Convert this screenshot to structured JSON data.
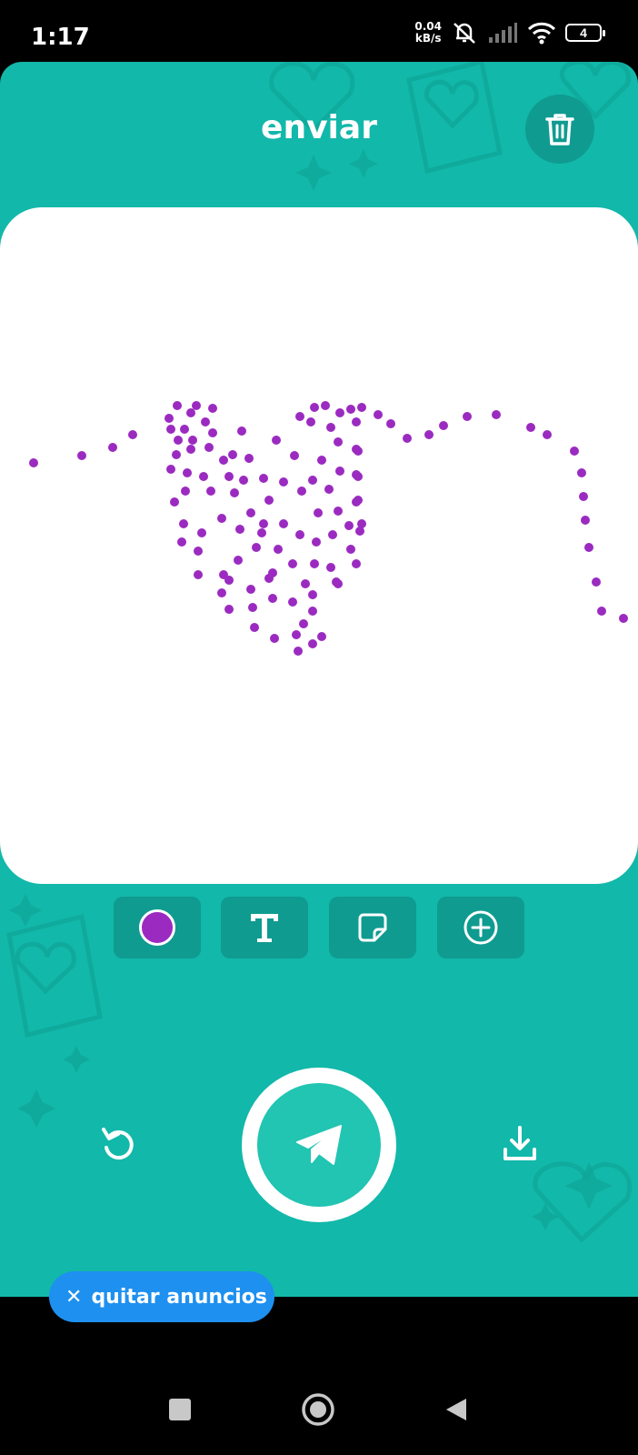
{
  "status_bar": {
    "time": "1:17",
    "net_speed_value": "0.04",
    "net_speed_unit": "kB/s",
    "battery_level": "4"
  },
  "header": {
    "title": "enviar",
    "trash_icon": "trash-icon"
  },
  "drawing": {
    "stroke_color": "#9b2bc0",
    "dot_count": 130
  },
  "tools": [
    {
      "name": "color-picker",
      "icon": "color-dot",
      "color": "#9b2bc0"
    },
    {
      "name": "text-tool",
      "icon": "text-T-icon"
    },
    {
      "name": "sticker-tool",
      "icon": "sticker-icon"
    },
    {
      "name": "add-tool",
      "icon": "plus-circle-icon"
    }
  ],
  "actions": {
    "undo_icon": "undo-icon",
    "send_icon": "paper-plane-icon",
    "download_icon": "download-icon"
  },
  "ads": {
    "close_glyph": "✕",
    "label": "quitar anuncios"
  },
  "colors": {
    "background": "#12b8aa",
    "button_dark": "#0f9b90",
    "send_inner": "#22c4b2",
    "ads_blue": "#1e90f0"
  }
}
